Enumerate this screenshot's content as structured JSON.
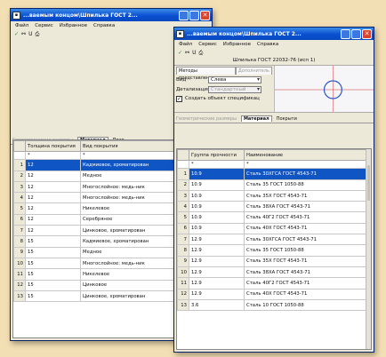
{
  "menu": [
    "Файл",
    "Сервис",
    "Избранное",
    "Справка"
  ],
  "toolbar": {
    "check": "✓",
    "find": "🔍",
    "lock": "U",
    "print": "⎙"
  },
  "w1": {
    "title": "...ваемым концом\\Шпилька ГОСТ 2...",
    "grid_tabs": [
      "Геометрические размеры",
      "Материал",
      "Покр"
    ],
    "columns": [
      "Толщина покрытия",
      "Вид покрытия"
    ],
    "filter": [
      "*",
      "*"
    ],
    "rows": [
      [
        "1",
        "12",
        "Кадмиевое, хроматирован"
      ],
      [
        "2",
        "12",
        "Медное"
      ],
      [
        "3",
        "12",
        "Многослойное: медь-ник"
      ],
      [
        "4",
        "12",
        "Многослойное: медь-ник"
      ],
      [
        "5",
        "12",
        "Никелевое"
      ],
      [
        "6",
        "12",
        "Серебряное"
      ],
      [
        "7",
        "12",
        "Цинковое, хроматирован"
      ],
      [
        "8",
        "15",
        "Кадмиевое, хроматирован"
      ],
      [
        "9",
        "15",
        "Медное"
      ],
      [
        "10",
        "15",
        "Многослойное: медь-ник"
      ],
      [
        "11",
        "15",
        "Никелевое"
      ],
      [
        "12",
        "15",
        "Цинковое"
      ],
      [
        "13",
        "15",
        "Цинковое, хроматирован"
      ]
    ]
  },
  "w2": {
    "title": "...ваемым концом\\Шпилька ГОСТ 2...",
    "caption": "Шпилька ГОСТ 22032-76 (исп 1)",
    "tabs": [
      "Методы представления",
      "Дополнитель"
    ],
    "view_label": "Вид",
    "view_value": "Слева",
    "detail_label": "Детализация",
    "detail_value": "Стандартный",
    "create_spec": "Создать объект спецификац",
    "grid_tabs": [
      "Геометрические размеры",
      "Материал",
      "Покрыти"
    ],
    "columns": [
      "Группа прочности",
      "Наименование"
    ],
    "filter": [
      "*",
      "*"
    ],
    "rows": [
      [
        "1",
        "10.9",
        "Сталь 30ХГСА ГОСТ 4543-71"
      ],
      [
        "2",
        "10.9",
        "Сталь 35 ГОСТ 1050-88"
      ],
      [
        "3",
        "10.9",
        "Сталь 35Х ГОСТ 4543-71"
      ],
      [
        "4",
        "10.9",
        "Сталь 38ХА ГОСТ 4543-71"
      ],
      [
        "5",
        "10.9",
        "Сталь 40Г2 ГОСТ 4543-71"
      ],
      [
        "6",
        "10.9",
        "Сталь 40Х ГОСТ 4543-71"
      ],
      [
        "7",
        "12.9",
        "Сталь 30ХГСА ГОСТ 4543-71"
      ],
      [
        "8",
        "12.9",
        "Сталь 35 ГОСТ 1050-88"
      ],
      [
        "9",
        "12.9",
        "Сталь 35Х ГОСТ 4543-71"
      ],
      [
        "10",
        "12.9",
        "Сталь 38ХА ГОСТ 4543-71"
      ],
      [
        "11",
        "12.9",
        "Сталь 40Г2 ГОСТ 4543-71"
      ],
      [
        "12",
        "12.9",
        "Сталь 40Х ГОСТ 4543-71"
      ],
      [
        "13",
        "3.6",
        "Сталь 10 ГОСТ 1050-88"
      ]
    ]
  }
}
